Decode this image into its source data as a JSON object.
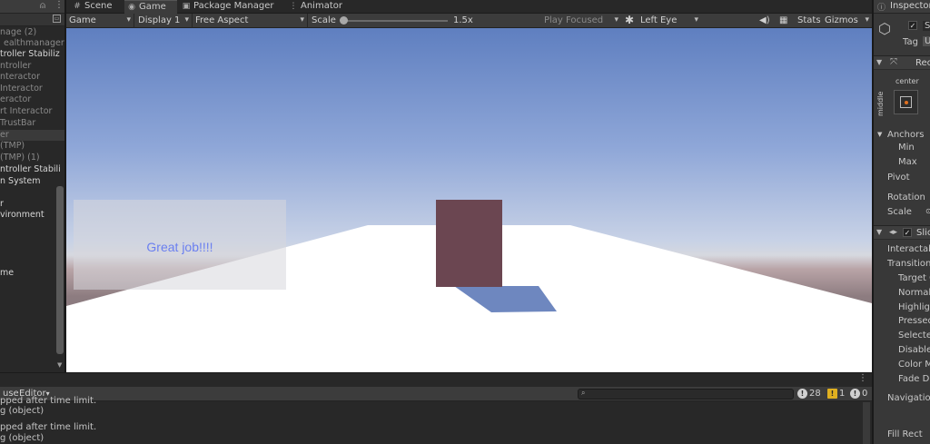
{
  "hierarchy": {
    "items": [
      "nage (2)",
      "ealthmanager",
      "troller Stabiliz",
      "ntroller",
      "nteractor",
      "Interactor",
      "eractor",
      "rt Interactor",
      "TrustBar",
      "er",
      " (TMP)",
      " (TMP) (1)",
      "ntroller Stabili",
      "n System",
      "r",
      "vironment",
      "me"
    ]
  },
  "tabs": [
    {
      "label": "Scene",
      "icon": "hash-icon"
    },
    {
      "label": "Game",
      "icon": "gamepad-icon"
    },
    {
      "label": "Package Manager",
      "icon": "package-icon"
    },
    {
      "label": "Animator",
      "icon": "animator-icon"
    }
  ],
  "toolbar": {
    "mode": "Game",
    "display": "Display 1",
    "aspect": "Free Aspect",
    "scale_label": "Scale",
    "scale_value": "1.5x",
    "play_focused": "Play Focused",
    "eye": "Left Eye",
    "stats": "Stats",
    "gizmos": "Gizmos"
  },
  "game": {
    "ui_text": "Great job!!!!"
  },
  "console": {
    "clear_label": "use",
    "editor_label": "Editor",
    "search_placeholder": "",
    "errors_count": "28",
    "warnings_count": "1",
    "info_count": "0",
    "logs": [
      "pped after time limit.",
      "g (object)",
      "pped after time limit.",
      "g (object)"
    ]
  },
  "inspector": {
    "title": "Inspector",
    "name_field": "S",
    "tag_label": "Tag",
    "tag_value": "U",
    "rect_header": "Rec",
    "anchor_center": "center",
    "anchor_middle": "middle",
    "anchors_label": "Anchors",
    "min_label": "Min",
    "max_label": "Max",
    "pivot_label": "Pivot",
    "rotation_label": "Rotation",
    "scale_label": "Scale",
    "slider_header": "Slic",
    "fields": [
      "Interactab",
      "Transition",
      "Target G",
      "Normal",
      "Highligh",
      "Pressed",
      "Selecte",
      "Disable",
      "Color M",
      "Fade Du"
    ],
    "navigation_label": "Navigation",
    "fill_rect_label": "Fill Rect"
  },
  "colors": {
    "accent_selection": "#3a3a3a",
    "ui_text": "#6a7ff0",
    "cube": "#6b4651",
    "warning": "#e0b020"
  }
}
